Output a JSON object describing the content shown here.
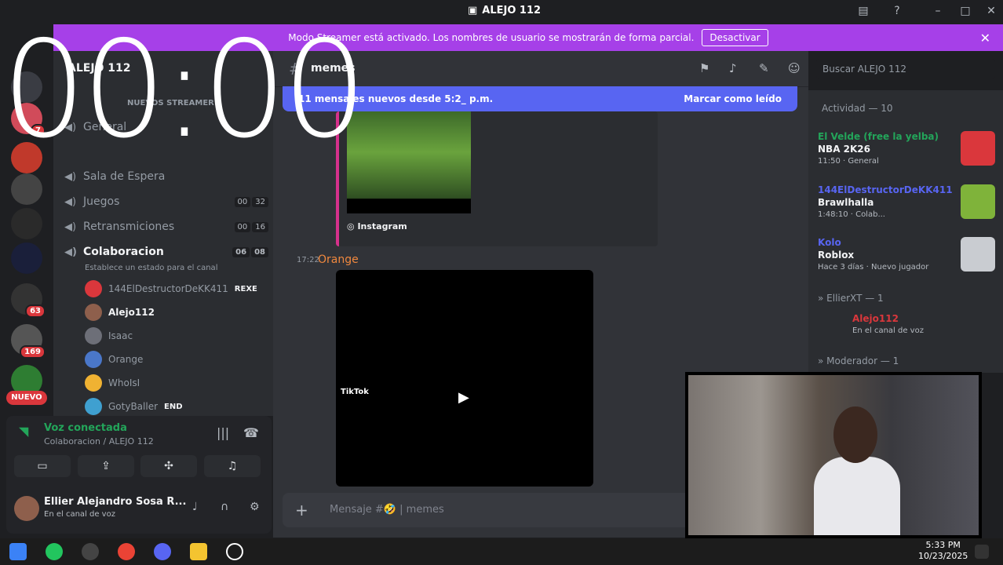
{
  "window": {
    "title": "ALEJO 112"
  },
  "banner": {
    "text": "Modo Streamer está activado. Los nombres de usuario se mostrarán de forma parcial.",
    "button": "Desactivar"
  },
  "overlay": {
    "timer": "00:00"
  },
  "servers": {
    "badges": [
      "7",
      "63",
      "169"
    ],
    "new_label": "NUEVO"
  },
  "guild": {
    "name": "ALEJO 112"
  },
  "channels": {
    "new_streamer": "NUEVOS STREAMER",
    "items": [
      {
        "name": "General",
        "counts": []
      },
      {
        "name": "Sala de Espera",
        "counts": []
      },
      {
        "name": "Juegos",
        "counts": [
          "00",
          "32"
        ]
      },
      {
        "name": "Retransmiciones",
        "counts": [
          "00",
          "16"
        ]
      },
      {
        "name": "Colaboracion",
        "counts": [
          "06",
          "08"
        ]
      }
    ],
    "status_hint": "Establece un estado para el canal",
    "voice_users": [
      {
        "name": "144ElDestructorDeKK411",
        "tag": "REXE",
        "color": "#da373c"
      },
      {
        "name": "Alejo112",
        "tag": "",
        "color": "#8e5f4c"
      },
      {
        "name": "Isaac",
        "tag": "",
        "color": "#6d6f78"
      },
      {
        "name": "Orange",
        "tag": "",
        "color": "#4a77c9"
      },
      {
        "name": "WhoIsI",
        "tag": "",
        "color": "#f0b232"
      },
      {
        "name": "GotyBaller",
        "tag": "END",
        "color": "#3fa0d0"
      }
    ]
  },
  "voice_panel": {
    "status": "Voz conectada",
    "location": "Colaboracion / ALEJO 112"
  },
  "user": {
    "name": "Ellier Alejandro Sosa R...",
    "status": "En el canal de voz"
  },
  "chat": {
    "channel": "memes",
    "new_messages": "11 mensajes nuevos desde 5:2_ p.m.",
    "mark_read": "Marcar como leído",
    "embed_source": "Instagram",
    "message_time": "17:22",
    "message_author": "Orange",
    "video_brand": "TikTok",
    "composer_placeholder": "Mensaje #🤣 | memes"
  },
  "search": {
    "placeholder": "Buscar ALEJO 112"
  },
  "activity": {
    "header": "Actividad — 10",
    "items": [
      {
        "user": "El Velde (free la yelba)",
        "user_color": "#23a55a",
        "game": "NBA 2K26",
        "meta": "11:50 · General",
        "thumb_color": "#da373c"
      },
      {
        "user": "144ElDestructorDeKK411",
        "user_color": "#5865f2",
        "game": "Brawlhalla",
        "meta": "1:48:10 · Colab...",
        "thumb_color": "#7fb33a"
      },
      {
        "user": "Kolo",
        "user_color": "#5865f2",
        "game": "Roblox",
        "meta": "Hace 3 días · Nuevo jugador",
        "thumb_color": "#c9ccd1"
      }
    ],
    "group1": "» EllierXT — 1",
    "group1_user": "Alejo112",
    "group1_status": "En el canal de voz",
    "group2": "» Moderador — 1"
  },
  "taskbar": {
    "time": "5:33 PM",
    "date": "10/23/2025"
  }
}
